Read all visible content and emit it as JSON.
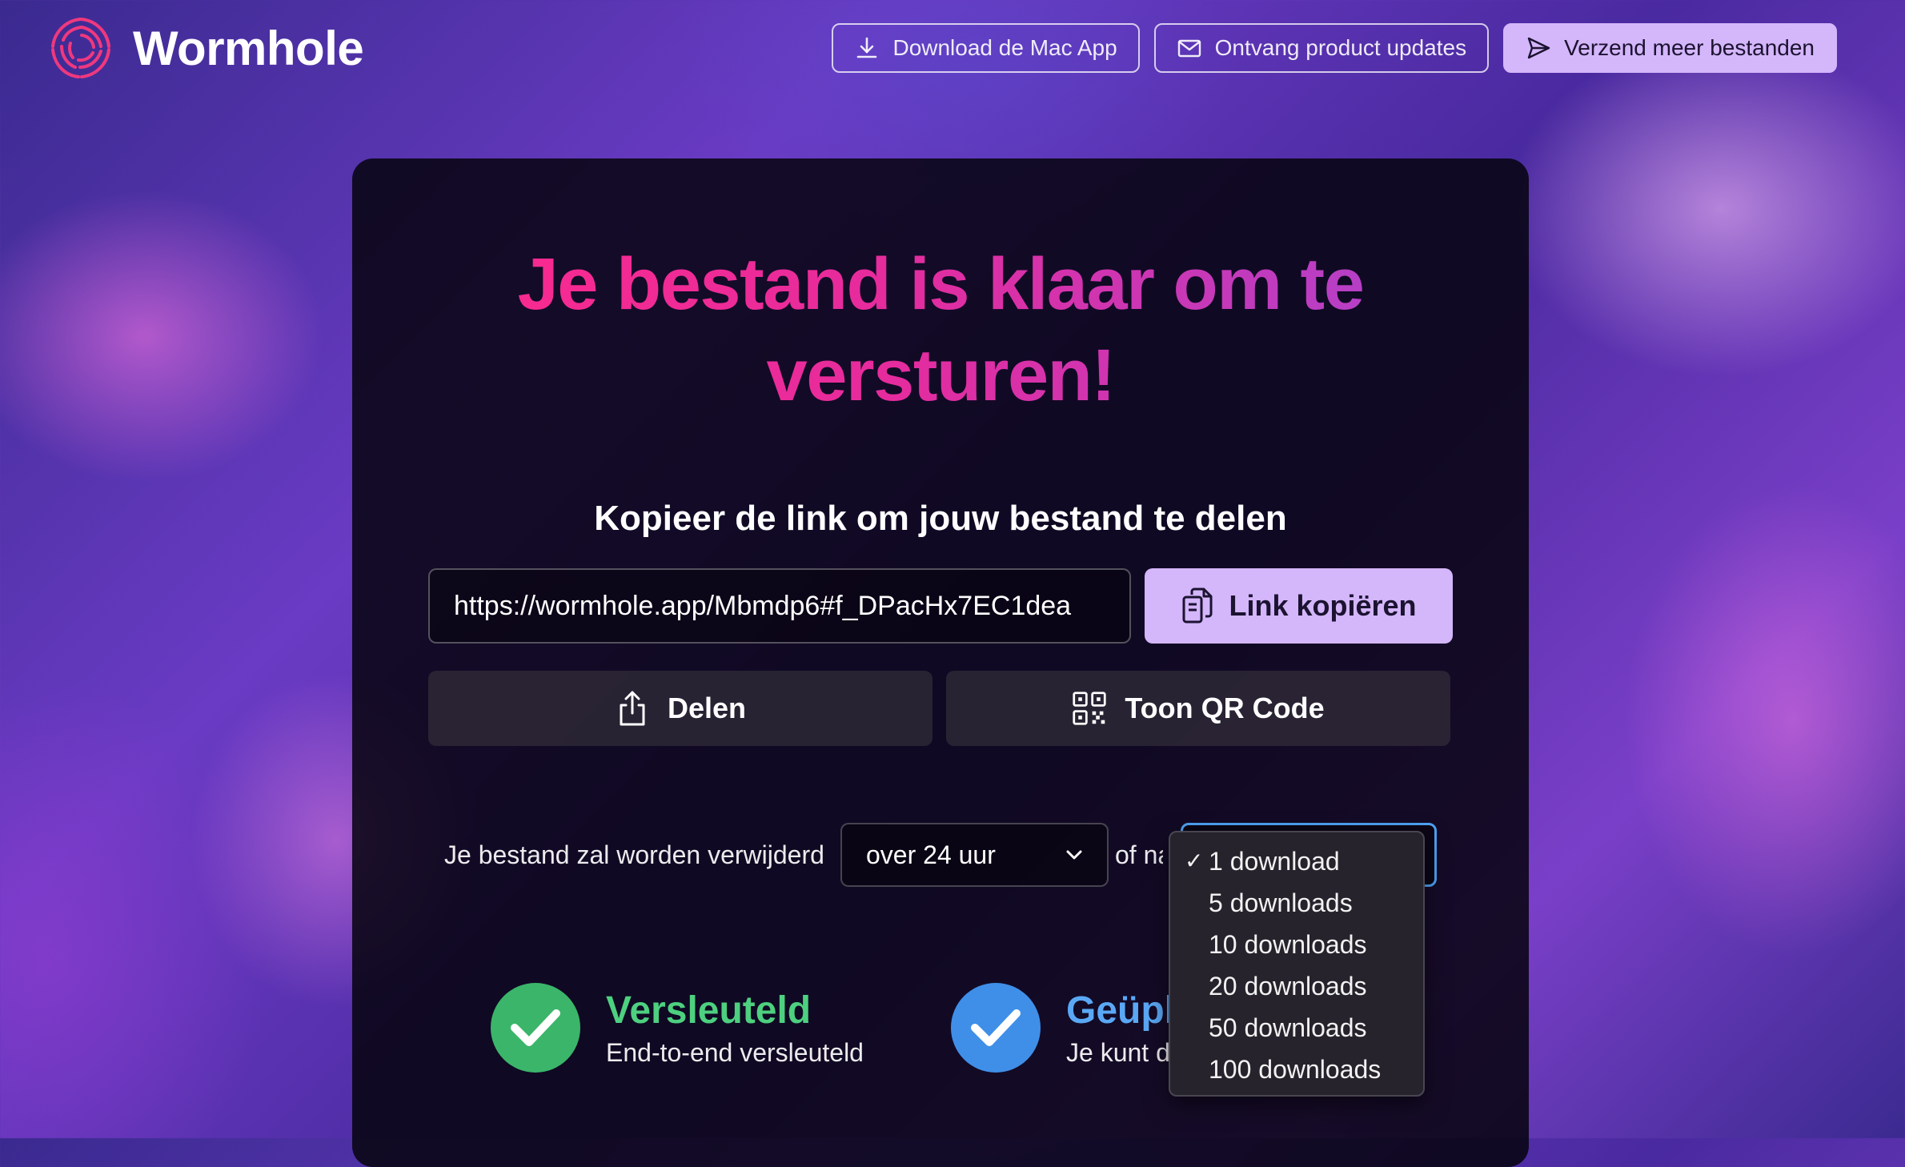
{
  "app": {
    "name": "Wormhole"
  },
  "nav": {
    "download_mac": "Download de Mac App",
    "product_updates": "Ontvang product updates",
    "send_more": "Verzend meer bestanden"
  },
  "main": {
    "headline": "Je bestand is klaar om te versturen!",
    "subtitle": "Kopieer de link om jouw bestand te delen",
    "link_value": "https://wormhole.app/Mbmdp6#f_DPacHx7EC1dea",
    "copy_label": "Link kopiëren",
    "share_label": "Delen",
    "qr_label": "Toon QR Code"
  },
  "expiry": {
    "label": "Je bestand zal worden verwijderd",
    "time_selected": "over 24 uur",
    "or_label": "of na",
    "downloads_options": [
      "1 download",
      "5 downloads",
      "10 downloads",
      "20 downloads",
      "50 downloads",
      "100 downloads"
    ],
    "downloads_selected_index": 0
  },
  "features": {
    "encrypted_title": "Versleuteld",
    "encrypted_desc": "End-to-end versleuteld",
    "uploaded_title": "Geüpl",
    "uploaded_desc": "Je kunt d"
  },
  "colors": {
    "accent": "#d4b6fb",
    "green": "#3bb56a",
    "blue": "#3f8fe8",
    "focus": "#4ea3f4"
  }
}
